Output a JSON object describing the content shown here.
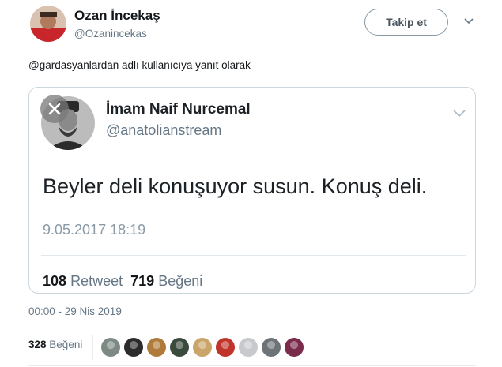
{
  "author": {
    "name": "Ozan İncekaş",
    "handle": "@Ozanincekas",
    "follow_label": "Takip et"
  },
  "reply_to": "@gardasyanlardan adlı kullanıcıya yanıt olarak",
  "quoted_tweet": {
    "name": "İmam Naif Nurcemal",
    "handle": "@anatolianstream",
    "text": "Beyler deli konuşuyor susun. Konuş deli.",
    "time": "9.05.2017 18:19",
    "retweet_count": "108",
    "retweet_label": "Retweet",
    "like_count": "719",
    "like_label": "Beğeni"
  },
  "timestamp": "00:00 - 29 Nis 2019",
  "likes": {
    "count": "328",
    "label": "Beğeni",
    "liker_colors": [
      "#7d8a84",
      "#2b2b2b",
      "#b07a3a",
      "#3a4a3c",
      "#c9a56a",
      "#c0352b",
      "#c7c9cc",
      "#6e7378",
      "#7a2a4a"
    ]
  }
}
